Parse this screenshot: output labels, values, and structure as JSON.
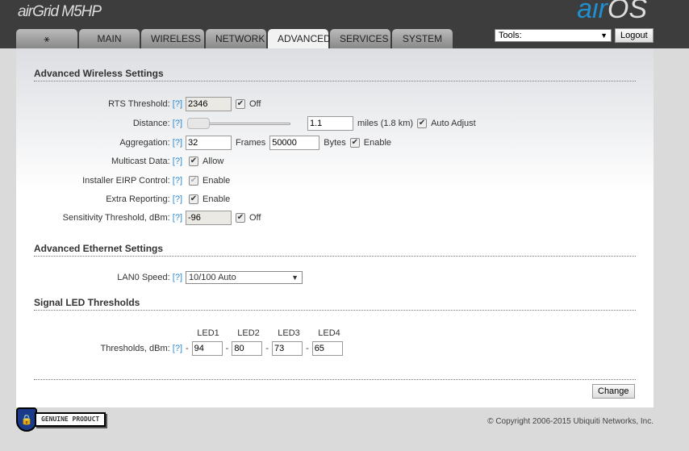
{
  "header": {
    "brand": "airGrid M5HP",
    "logo_air": "air",
    "logo_os": "OS"
  },
  "tabs": [
    {
      "label": ""
    },
    {
      "label": "MAIN"
    },
    {
      "label": "WIRELESS"
    },
    {
      "label": "NETWORK"
    },
    {
      "label": "ADVANCED"
    },
    {
      "label": "SERVICES"
    },
    {
      "label": "SYSTEM"
    }
  ],
  "tools": {
    "value": "Tools:",
    "logout": "Logout"
  },
  "help": "[?]",
  "wireless": {
    "title": "Advanced Wireless Settings",
    "rts": {
      "label": "RTS Threshold:",
      "value": "2346",
      "off": "Off"
    },
    "distance": {
      "label": "Distance:",
      "value": "1.1",
      "unit": "miles (1.8 km)",
      "auto": "Auto Adjust",
      "slider_fraction": 0
    },
    "aggregation": {
      "label": "Aggregation:",
      "frames": "32",
      "frames_label": "Frames",
      "bytes": "50000",
      "bytes_label": "Bytes",
      "enable": "Enable"
    },
    "multicast": {
      "label": "Multicast Data:",
      "allow": "Allow"
    },
    "eirp": {
      "label": "Installer EIRP Control:",
      "enable": "Enable"
    },
    "extra": {
      "label": "Extra Reporting:",
      "enable": "Enable"
    },
    "sensitivity": {
      "label": "Sensitivity Threshold, dBm:",
      "value": "-96",
      "off": "Off"
    }
  },
  "ethernet": {
    "title": "Advanced Ethernet Settings",
    "lan0": {
      "label": "LAN0 Speed:",
      "value": "10/100 Auto"
    }
  },
  "led": {
    "title": "Signal LED Thresholds",
    "label": "Thresholds, dBm:",
    "dash": "-",
    "headers": [
      "LED1",
      "LED2",
      "LED3",
      "LED4"
    ],
    "values": [
      "94",
      "80",
      "73",
      "65"
    ]
  },
  "change": "Change",
  "footer": {
    "badge": "GENUINE PRODUCT",
    "copyright": "© Copyright 2006-2015 Ubiquiti Networks, Inc."
  }
}
